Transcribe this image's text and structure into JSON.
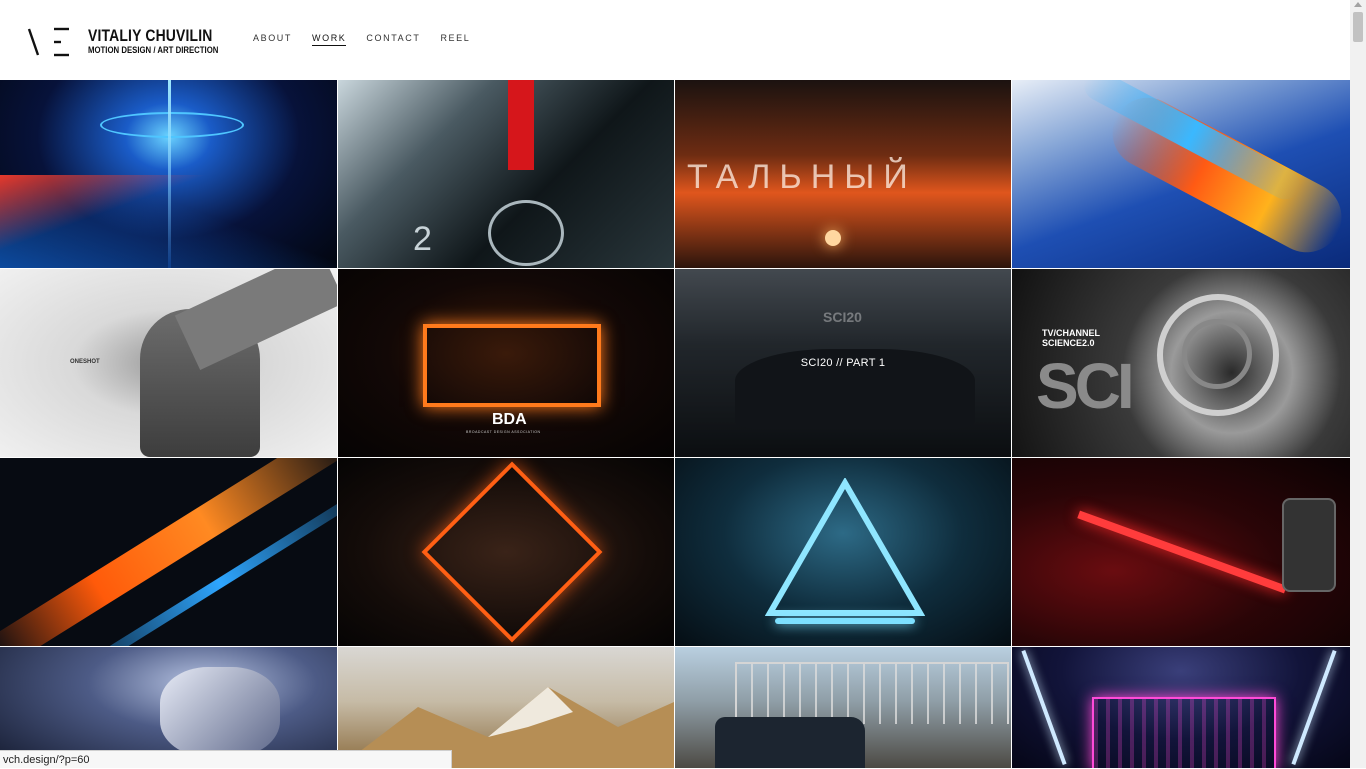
{
  "brand": {
    "name": "VITALIY CHUVILIN",
    "tagline": "MOTION DESIGN / ART DIRECTION"
  },
  "nav": [
    {
      "label": "ABOUT",
      "active": false
    },
    {
      "label": "WORK",
      "active": true
    },
    {
      "label": "CONTACT",
      "active": false
    },
    {
      "label": "REEL",
      "active": false
    }
  ],
  "hover_caption": "SCI20 // PART 1",
  "tile_texts": {
    "oneshot": "ONESHOT",
    "bda_logo": "BDA",
    "bda_sub": "BROADCAST DESIGN ASSOCIATION",
    "sci20_logo": "SCI20",
    "tv_channel": "TV/CHANNEL",
    "science": "SCIENCE2.0",
    "sci": "SCI",
    "cyrillic": "ТАЛЬНЫЙ"
  },
  "status_url": "vch.design/?p=60"
}
